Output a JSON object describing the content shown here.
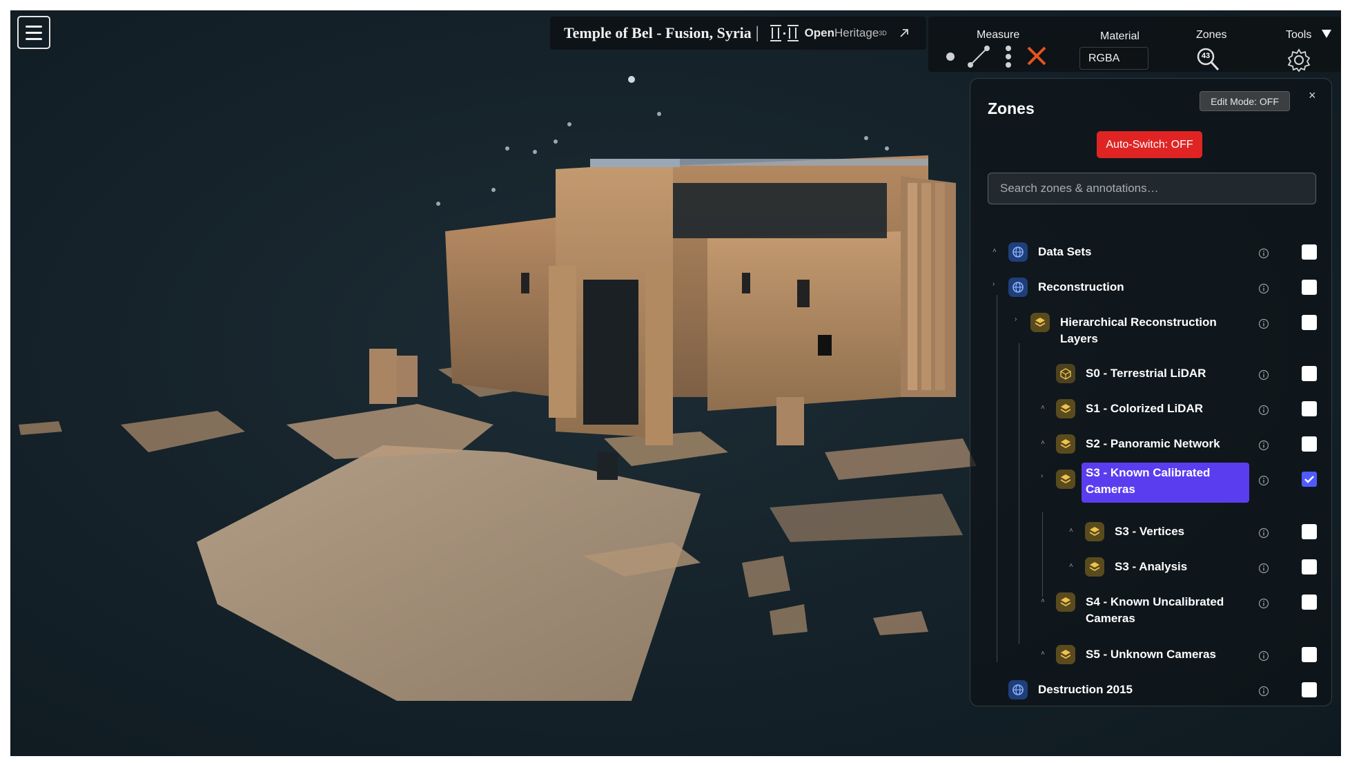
{
  "title": {
    "text": "Temple of Bel - Fusion, Syria",
    "separator": "|",
    "logo_open": "Open",
    "logo_heritage": "Heritage",
    "logo_3d": "3D"
  },
  "toolbar": {
    "measure_label": "Measure",
    "material_label": "Material",
    "material_value": "RGBA",
    "zones_label": "Zones",
    "zones_badge": "43",
    "tools_label": "Tools"
  },
  "zones_panel": {
    "title": "Zones",
    "edit_mode_label": "Edit Mode: OFF",
    "close_symbol": "×",
    "auto_switch_label": "Auto-Switch: OFF",
    "search_placeholder": "Search zones & annotations…",
    "items": [
      {
        "label": "Data Sets",
        "icon": "globe-icon",
        "checked": false
      },
      {
        "label": "Reconstruction",
        "icon": "globe-icon",
        "checked": false
      },
      {
        "label": "Hierarchical Reconstruction Layers",
        "icon": "layers-icon",
        "checked": false
      },
      {
        "label": "S0 - Terrestrial LiDAR",
        "icon": "cube-icon",
        "checked": false
      },
      {
        "label": "S1 - Colorized LiDAR",
        "icon": "layers-icon",
        "checked": false
      },
      {
        "label": "S2 - Panoramic Network",
        "icon": "layers-icon",
        "checked": false
      },
      {
        "label": "S3 - Known Calibrated Cameras",
        "icon": "layers-icon",
        "checked": true,
        "selected": true
      },
      {
        "label": "S3 - Vertices",
        "icon": "layers-icon",
        "checked": false
      },
      {
        "label": "S3 - Analysis",
        "icon": "layers-icon",
        "checked": false
      },
      {
        "label": "S4 - Known Uncalibrated Cameras",
        "icon": "layers-icon",
        "checked": false
      },
      {
        "label": "S5 - Unknown Cameras",
        "icon": "layers-icon",
        "checked": false
      },
      {
        "label": "Destruction 2015",
        "icon": "globe-icon",
        "checked": false
      }
    ]
  },
  "colors": {
    "background": "#16232b",
    "stone": "#b8926a",
    "accent_selected": "#5b3df0",
    "auto_switch": "#e02424",
    "checkbox_on": "#4f5bff",
    "measure_clear": "#e8531f"
  }
}
